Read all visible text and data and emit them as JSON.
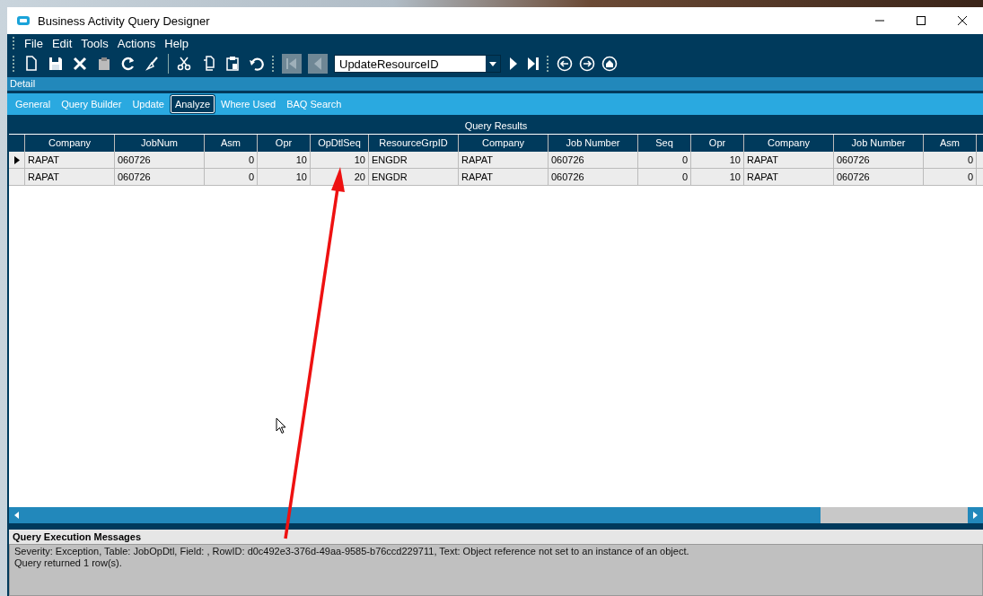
{
  "window": {
    "title": "Business Activity Query Designer"
  },
  "menu": [
    "File",
    "Edit",
    "Tools",
    "Actions",
    "Help"
  ],
  "toolbar": {
    "record_combo": {
      "value": "UpdateResourceID"
    }
  },
  "detail_bar": {
    "title": "Detail"
  },
  "tabs": [
    {
      "label": "General",
      "selected": false
    },
    {
      "label": "Query Builder",
      "selected": false
    },
    {
      "label": "Update",
      "selected": false
    },
    {
      "label": "Analyze",
      "selected": true
    },
    {
      "label": "Where Used",
      "selected": false
    },
    {
      "label": "BAQ Search",
      "selected": false
    }
  ],
  "results": {
    "title": "Query Results",
    "columns": [
      {
        "label": "Company",
        "kind": "text"
      },
      {
        "label": "JobNum",
        "kind": "text"
      },
      {
        "label": "Asm",
        "kind": "number"
      },
      {
        "label": "Opr",
        "kind": "number"
      },
      {
        "label": "OpDtlSeq",
        "kind": "number"
      },
      {
        "label": "ResourceGrpID",
        "kind": "text"
      },
      {
        "label": "Company",
        "kind": "text"
      },
      {
        "label": "Job Number",
        "kind": "text"
      },
      {
        "label": "Seq",
        "kind": "number"
      },
      {
        "label": "Opr",
        "kind": "number"
      },
      {
        "label": "Company",
        "kind": "text"
      },
      {
        "label": "Job Number",
        "kind": "text"
      },
      {
        "label": "Asm",
        "kind": "number"
      }
    ],
    "rows": [
      {
        "current": true,
        "cells": [
          "RAPAT",
          "060726",
          "0",
          "10",
          "10",
          "ENGDR",
          "RAPAT",
          "060726",
          "0",
          "10",
          "RAPAT",
          "060726",
          "0"
        ]
      },
      {
        "current": false,
        "cells": [
          "RAPAT",
          "060726",
          "0",
          "10",
          "20",
          "ENGDR",
          "RAPAT",
          "060726",
          "0",
          "10",
          "RAPAT",
          "060726",
          "0"
        ]
      }
    ]
  },
  "messages": {
    "title": "Query Execution Messages",
    "lines": [
      "Severity: Exception, Table: JobOpDtl, Field: , RowID: d0c492e3-376d-49aa-9585-b76ccd229711, Text: Object reference not set to an instance of an object.",
      "Query returned 1 row(s)."
    ]
  },
  "annotation_arrow": true,
  "mouse_cursor": true
}
